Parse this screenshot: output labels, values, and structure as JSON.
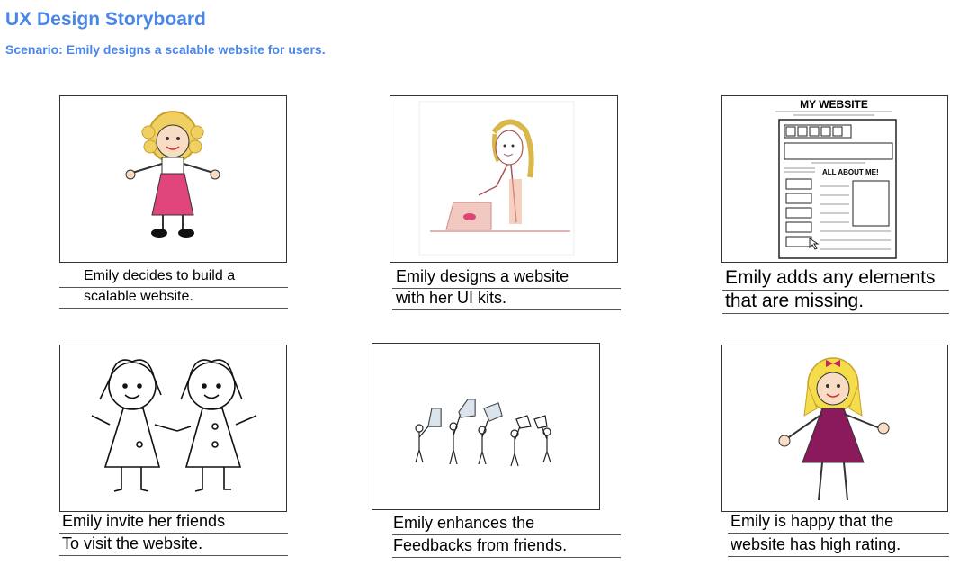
{
  "header": {
    "title": "UX Design Storyboard",
    "subtitle": "Scenario: Emily designs a scalable website for users."
  },
  "panels": [
    {
      "line1": "Emily decides to build a",
      "line2": "scalable website.",
      "image": "girl-pink-dress-illustration"
    },
    {
      "line1": "Emily designs a  website",
      "line2": "with her UI kits.",
      "image": "girl-with-laptop-illustration"
    },
    {
      "line1": "Emily adds any elements",
      "line2": "that are missing.",
      "image": "website-wireframe-sketch",
      "wireframe": {
        "heading": "MY WEBSITE",
        "section": "ALL ABOUT ME!"
      }
    },
    {
      "line1": "Emily invite her friends",
      "line2": "To visit the website.",
      "image": "two-girls-holding-hands-sketch"
    },
    {
      "line1": "Emily enhances the",
      "line2": "Feedbacks from friends.",
      "image": "people-holding-thumbs-up-sketch"
    },
    {
      "line1": "Emily is happy that the",
      "line2": "website has high rating.",
      "image": "happy-girl-purple-dress-illustration"
    }
  ],
  "colors": {
    "accent": "#4a86e8",
    "pink_dress": "#e0457b",
    "purple_dress": "#8b1a5c",
    "laptop": "#f2c9c0",
    "hair": "#f0d060"
  }
}
